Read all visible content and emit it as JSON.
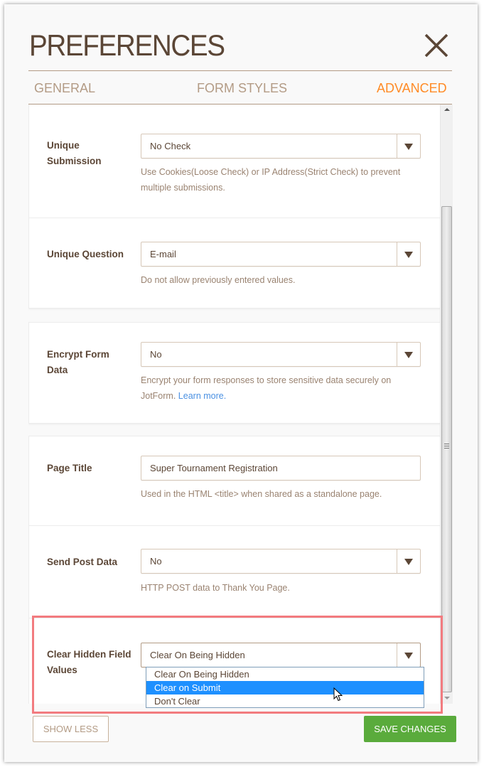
{
  "dialog": {
    "title": "PREFERENCES",
    "close_icon": "close-icon"
  },
  "tabs": [
    {
      "label": "GENERAL",
      "active": false
    },
    {
      "label": "FORM STYLES",
      "active": false
    },
    {
      "label": "ADVANCED",
      "active": true
    }
  ],
  "settings": {
    "unique_submission": {
      "label_line1": "Unique",
      "label_line2": "Submission",
      "value": "No Check",
      "help": "Use Cookies(Loose Check) or IP Address(Strict Check) to prevent multiple submissions."
    },
    "unique_question": {
      "label": "Unique Question",
      "value": "E-mail",
      "help": "Do not allow previously entered values."
    },
    "encrypt_form_data": {
      "label_line1": "Encrypt Form",
      "label_line2": "Data",
      "value": "No",
      "help": "Encrypt your form responses to store sensitive data securely on JotForm.",
      "help_link": "Learn more."
    },
    "page_title": {
      "label": "Page Title",
      "value": "Super Tournament Registration",
      "help": "Used in the HTML <title> when shared as a standalone page."
    },
    "send_post_data": {
      "label": "Send Post Data",
      "value": "No",
      "help": "HTTP POST data to Thank You Page."
    },
    "clear_hidden_field_values": {
      "label_line1": "Clear Hidden Field",
      "label_line2": "Values",
      "value": "Clear On Being Hidden",
      "options": [
        "Clear On Being Hidden",
        "Clear on Submit",
        "Don't Clear"
      ],
      "hovered_option": "Clear on Submit"
    }
  },
  "footer": {
    "show_less_label": "SHOW LESS",
    "save_label": "SAVE CHANGES"
  },
  "colors": {
    "accent": "#ff8b26",
    "text_brown": "#5b4636",
    "tab_inactive": "#b39b85",
    "save_green": "#5aab3c",
    "highlight_red": "#f27b7f",
    "option_hover": "#1e90ff",
    "link_blue": "#4a90e2"
  }
}
